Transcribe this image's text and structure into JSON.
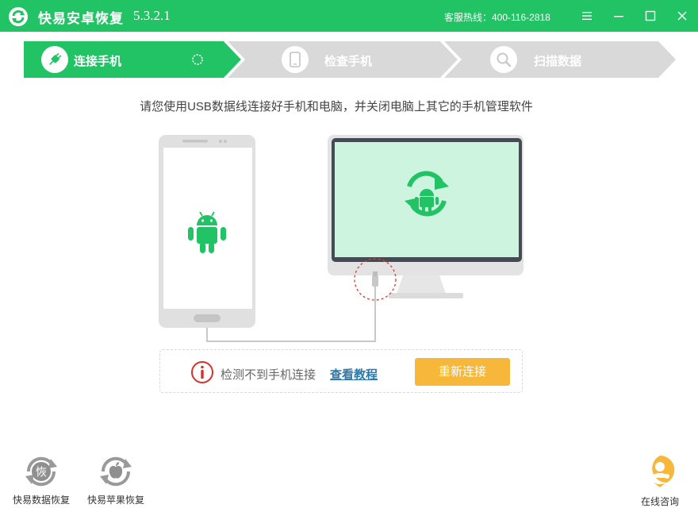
{
  "titlebar": {
    "app_name": "快易安卓恢复",
    "version": "5.3.2.1",
    "hotline": "客服热线：400-116-2818"
  },
  "steps": [
    {
      "label": "连接手机",
      "icon": "plug-icon",
      "state": "active"
    },
    {
      "label": "检查手机",
      "icon": "phone-icon",
      "state": "pending"
    },
    {
      "label": "扫描数据",
      "icon": "search-icon",
      "state": "pending"
    }
  ],
  "instruction": "请您使用USB数据线连接好手机和电脑，并关闭电脑上其它的手机管理软件",
  "detect": {
    "message": "检测不到手机连接",
    "tutorial_link": "查看教程",
    "reconnect_button": "重新连接"
  },
  "bottom": {
    "data_recovery_label": "快易数据恢复",
    "data_recovery_glyph": "恢",
    "apple_recovery_label": "快易苹果恢复",
    "online_consult_label": "在线咨询"
  },
  "colors": {
    "brand_green": "#21c364",
    "accent_orange": "#f7b73b",
    "link_blue": "#2a7ab0",
    "warning_red": "#d9302c",
    "step_inactive": "#d9d9d9"
  }
}
